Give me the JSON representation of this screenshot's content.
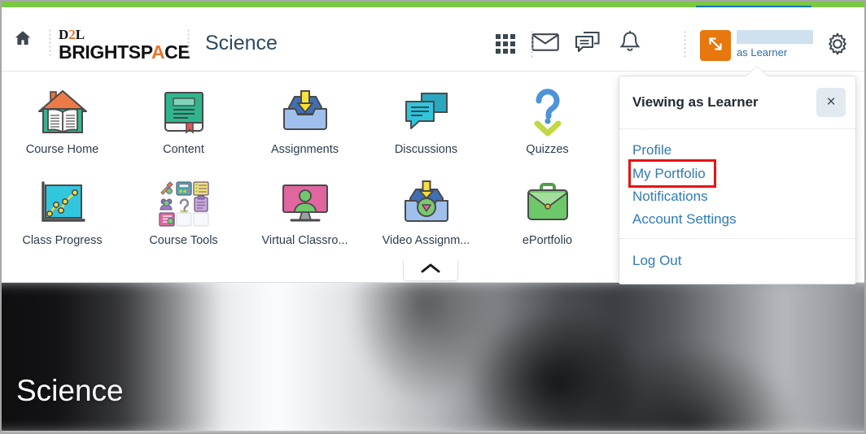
{
  "theme": {
    "green_bar": "#7ac943",
    "blue_tab": "#0a72c4",
    "orange_accent": "#e8770d",
    "link_blue": "#2f7ab8",
    "highlight_red": "#e81313"
  },
  "header": {
    "home_icon": "home-icon",
    "brand_line1": "D2L",
    "brand_line1_accent": "2",
    "brand_line2": "BRIGHTSPACE",
    "course_title": "Science",
    "nav_icons": [
      {
        "name": "course-selector-grid-icon",
        "label": "Select a course"
      },
      {
        "name": "message-envelope-icon",
        "label": "Messages"
      },
      {
        "name": "subscription-chat-icon",
        "label": "Subscriptions"
      },
      {
        "name": "notifications-bell-icon",
        "label": "Notifications"
      }
    ],
    "role_switch_icon": "role-switch-arrows-icon",
    "user_name_redacted": "",
    "user_role_text": "as Learner",
    "settings_icon": "gear-icon"
  },
  "course_nav": {
    "tiles": [
      {
        "label": "Course Home",
        "icon": "course-home-icon"
      },
      {
        "label": "Content",
        "icon": "content-book-icon"
      },
      {
        "label": "Assignments",
        "icon": "assignments-inbox-icon"
      },
      {
        "label": "Discussions",
        "icon": "discussions-bubbles-icon"
      },
      {
        "label": "Quizzes",
        "icon": "quizzes-question-check-icon"
      },
      {
        "label": "Class Progress",
        "icon": "class-progress-chart-icon"
      },
      {
        "label": "Course Tools",
        "icon": "course-tools-grid-icon"
      },
      {
        "label": "Virtual Classro...",
        "icon": "virtual-classroom-monitor-icon"
      },
      {
        "label": "Video Assignm...",
        "icon": "video-assignments-icon"
      },
      {
        "label": "ePortfolio",
        "icon": "eportfolio-briefcase-icon"
      }
    ],
    "collapse_icon": "chevron-up-icon"
  },
  "dropdown": {
    "title": "Viewing as Learner",
    "close_label": "×",
    "links": [
      {
        "label": "Profile",
        "highlighted": false
      },
      {
        "label": "My Portfolio",
        "highlighted": true
      },
      {
        "label": "Notifications",
        "highlighted": false
      },
      {
        "label": "Account Settings",
        "highlighted": false
      }
    ],
    "logout_label": "Log Out"
  },
  "banner": {
    "title": "Science"
  }
}
